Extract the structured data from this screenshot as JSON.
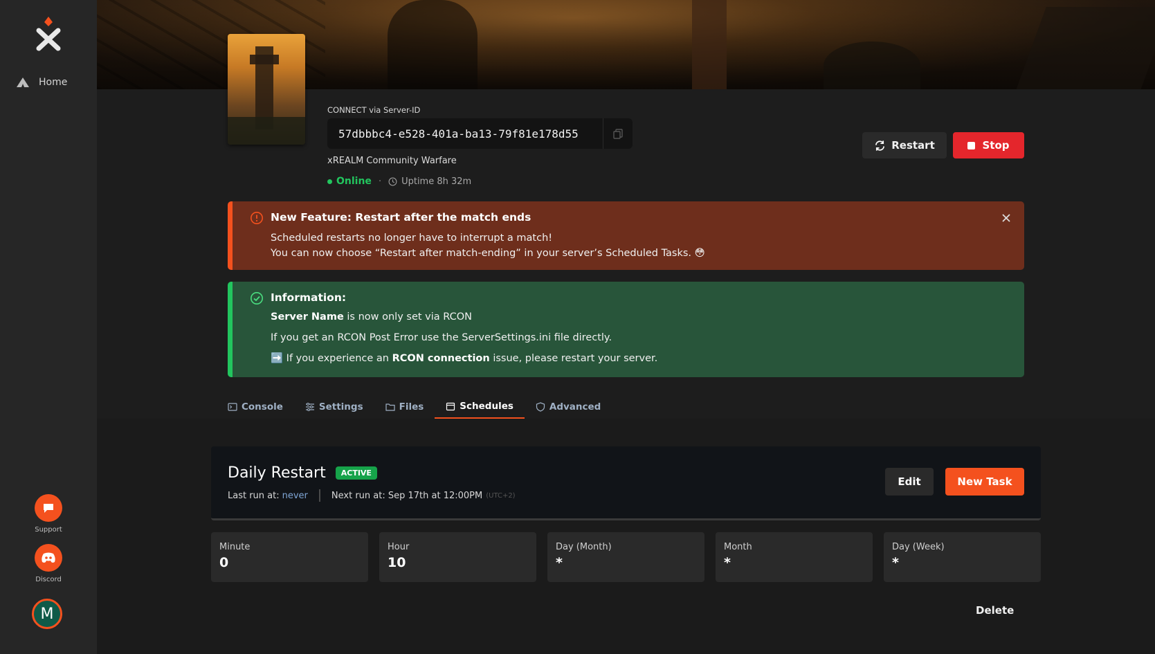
{
  "sidebar": {
    "nav": [
      {
        "label": "Home",
        "icon": "tent-icon"
      }
    ],
    "support_label": "Support",
    "discord_label": "Discord",
    "avatar_initial": "M"
  },
  "server": {
    "connect_label": "CONNECT via Server-ID",
    "server_id": "57dbbbc4-e528-401a-ba13-79f81e178d55",
    "name": "xREALM Community Warfare",
    "status": "Online",
    "separator": "·",
    "uptime": "Uptime 8h 32m"
  },
  "actions": {
    "restart_label": "Restart",
    "stop_label": "Stop"
  },
  "alerts": {
    "feature": {
      "title": "New Feature: Restart after the match ends",
      "line1": "Scheduled restarts no longer have to interrupt a match!",
      "line2": "You can now choose “Restart after match-ending” in your server’s Scheduled Tasks. 😳"
    },
    "info": {
      "title": "Information:",
      "line1_bold": "Server Name",
      "line1_rest": " is now only set via RCON",
      "line2": "If you get an RCON Post Error use the ServerSettings.ini file directly.",
      "line3_emoji": "➡️",
      "line3_pre": " If you experience an ",
      "line3_bold": "RCON connection",
      "line3_post": " issue, please restart your server."
    }
  },
  "tabs": [
    {
      "label": "Console",
      "icon": "console-icon"
    },
    {
      "label": "Settings",
      "icon": "sliders-icon"
    },
    {
      "label": "Files",
      "icon": "folder-icon"
    },
    {
      "label": "Schedules",
      "icon": "calendar-icon",
      "active": true
    },
    {
      "label": "Advanced",
      "icon": "shield-icon"
    }
  ],
  "schedule": {
    "title": "Daily Restart",
    "badge": "ACTIVE",
    "last_run_label": "Last run at:",
    "last_run_value": "never",
    "next_run": "Next run at: Sep 17th at 12:00PM",
    "timezone": "(UTC+2)",
    "edit_label": "Edit",
    "new_task_label": "New Task",
    "delete_label": "Delete",
    "cron": [
      {
        "label": "Minute",
        "value": "0"
      },
      {
        "label": "Hour",
        "value": "10"
      },
      {
        "label": "Day (Month)",
        "value": "*"
      },
      {
        "label": "Month",
        "value": "*"
      },
      {
        "label": "Day (Week)",
        "value": "*"
      }
    ]
  },
  "colors": {
    "accent": "#f4511e",
    "online": "#22c55e",
    "stop": "#e4262c",
    "alert_orange_bg": "#6e2e1c",
    "alert_green_bg": "#28553a"
  }
}
